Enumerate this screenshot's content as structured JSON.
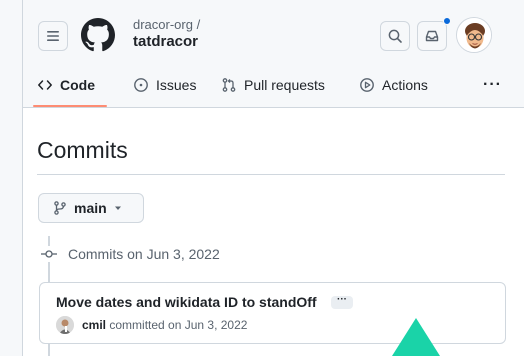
{
  "repo": {
    "owner": "dracor-org /",
    "name": "tatdracor"
  },
  "tabs": [
    {
      "label": "Code",
      "icon": "code-icon",
      "selected": true
    },
    {
      "label": "Issues",
      "icon": "issue-icon"
    },
    {
      "label": "Pull requests",
      "icon": "pull-request-icon"
    },
    {
      "label": "Actions",
      "icon": "play-icon"
    },
    {
      "label": "···",
      "icon": "more-icon"
    }
  ],
  "page": {
    "title": "Commits"
  },
  "branch": {
    "name": "main"
  },
  "timeline": {
    "group_label": "Commits on Jun 3, 2022"
  },
  "commits": [
    {
      "title": "Move dates and wikidata ID to standOff",
      "ellipsis": "···",
      "author": "cmil",
      "committed_text": "committed on Jun 3, 2022"
    }
  ],
  "colors": {
    "accent_underline": "#fd8c73",
    "notification_dot": "#0969da",
    "pointer_arrow": "#1ad3a8"
  }
}
